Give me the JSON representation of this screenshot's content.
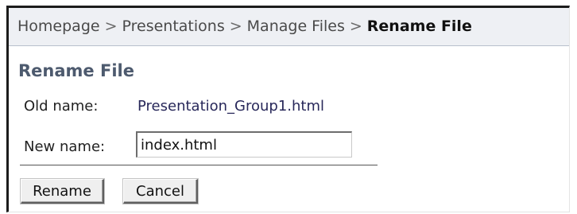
{
  "breadcrumb": {
    "items": [
      "Homepage",
      "Presentations",
      "Manage Files"
    ],
    "separator": ">",
    "current": "Rename File"
  },
  "form": {
    "heading": "Rename File",
    "old_name_label": "Old name:",
    "old_name_value": "Presentation_Group1.html",
    "new_name_label": "New name:",
    "new_name_value": "index.html"
  },
  "buttons": {
    "rename_label": "Rename",
    "cancel_label": "Cancel"
  },
  "colors": {
    "heading": "#4d5a6e",
    "breadcrumb_bg": "#eef0f4",
    "old_name_value": "#28285a"
  }
}
